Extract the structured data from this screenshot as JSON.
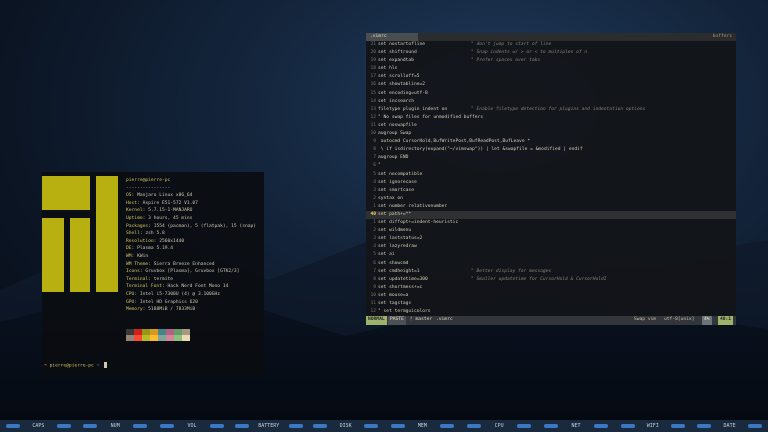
{
  "colors": {
    "accent_green": "#9fb26c",
    "manjaro_logo": "#b8b010",
    "term_key": "#d6c35e"
  },
  "terminal": {
    "user_host": "pierre@pierre-pc",
    "separator": "----------------",
    "info": [
      {
        "key": "OS",
        "value": "Manjaro Linux x86_64"
      },
      {
        "key": "Host",
        "value": "Aspire E51-572 V1.07"
      },
      {
        "key": "Kernel",
        "value": "5.7.15-1-MANJARO"
      },
      {
        "key": "Uptime",
        "value": "3 hours, 45 mins"
      },
      {
        "key": "Packages",
        "value": "1554 (pacman), 5 (flatpak), 15 (snap)"
      },
      {
        "key": "Shell",
        "value": "zsh 5.8"
      },
      {
        "key": "Resolution",
        "value": "2560x1440"
      },
      {
        "key": "DE",
        "value": "Plasma 5.19.4"
      },
      {
        "key": "WM",
        "value": "KWin"
      },
      {
        "key": "WM Theme",
        "value": "Sierra Breeze Enhanced"
      },
      {
        "key": "Icons",
        "value": "Gruvbox [Plasma], Gruvbox [GTK2/3]"
      },
      {
        "key": "Terminal",
        "value": "termite"
      },
      {
        "key": "Terminal Font",
        "value": "Hack Nerd Font Mono 14"
      },
      {
        "key": "CPU",
        "value": "Intel i5-7300U (4) @ 3.100GHz"
      },
      {
        "key": "GPU",
        "value": "Intel HD Graphics 620"
      },
      {
        "key": "Memory",
        "value": "5188MiB / 7833MiB"
      }
    ],
    "palette_row1": [
      "#3c3836",
      "#cc241d",
      "#98971a",
      "#d79921",
      "#458588",
      "#b16286",
      "#689d6a",
      "#a89984"
    ],
    "palette_row2": [
      "#928374",
      "#fb4934",
      "#b8bb26",
      "#fabd2f",
      "#83a598",
      "#d3869b",
      "#8ec07c",
      "#ebdbb2"
    ],
    "prompt": {
      "arrow": "➜",
      "host": "pierre@pierre-pc",
      "path": "~"
    }
  },
  "vim": {
    "tab_name": ".vimrc",
    "tab_right": "buffers",
    "lines": [
      {
        "num": "21",
        "code": "set nostartofline",
        "comment": "\" don't jump to start of line"
      },
      {
        "num": "20",
        "code": "set shiftround",
        "comment": "\" Snap indents w/ > or < to multiples of n"
      },
      {
        "num": "19",
        "code": "set expandtab",
        "comment": "\" Prefer spaces over tabs"
      },
      {
        "num": "18",
        "code": "set hls",
        "comment": ""
      },
      {
        "num": "17",
        "code": "set scrolloff=5",
        "comment": ""
      },
      {
        "num": "16",
        "code": "set showtabline=2",
        "comment": ""
      },
      {
        "num": "15",
        "code": "set encoding=utf-8",
        "comment": ""
      },
      {
        "num": "14",
        "code": "set incsearch",
        "comment": ""
      },
      {
        "num": "13",
        "code": "filetype plugin indent on",
        "comment": "\" Enable filetype detection for plugins and indentation options"
      },
      {
        "num": "12",
        "code": "\" No swap files for unmodified buffers",
        "comment": ""
      },
      {
        "num": "11",
        "code": "set noswapfile",
        "comment": ""
      },
      {
        "num": "10",
        "code": "augroup Swap",
        "comment": ""
      },
      {
        "num": "9",
        "code": "  autocmd CursorHold,BufWritePost,BufReadPost,BufLeave *",
        "comment": ""
      },
      {
        "num": "8",
        "code": "        \\ if isdirectory(expand(\"~/vimswap\")) | let &swapfile = &modified | endif",
        "comment": ""
      },
      {
        "num": "7",
        "code": "augroup END",
        "comment": ""
      },
      {
        "num": "6",
        "code": "\"",
        "comment": ""
      },
      {
        "num": "5",
        "code": "set nocompatible",
        "comment": ""
      },
      {
        "num": "4",
        "code": "set ignorecase",
        "comment": ""
      },
      {
        "num": "3",
        "code": "set smartcase",
        "comment": ""
      },
      {
        "num": "2",
        "code": "syntax on",
        "comment": ""
      },
      {
        "num": "1",
        "code": "set number relativenumber",
        "comment": ""
      },
      {
        "num": "40",
        "code": "set path+=**",
        "comment": ""
      },
      {
        "num": "1",
        "code": "set diffopt+=indent-heuristic",
        "comment": ""
      },
      {
        "num": "2",
        "code": "set wildmenu",
        "comment": ""
      },
      {
        "num": "3",
        "code": "set laststatus=2",
        "comment": ""
      },
      {
        "num": "4",
        "code": "set lazyredraw",
        "comment": ""
      },
      {
        "num": "5",
        "code": "set ai",
        "comment": ""
      },
      {
        "num": "6",
        "code": "set showcmd",
        "comment": ""
      },
      {
        "num": "7",
        "code": "set cmdheight=1",
        "comment": "\" Better display for messages"
      },
      {
        "num": "8",
        "code": "set updatetime=300",
        "comment": "\" Smaller updatetime for CursorHold & CursorHoldI"
      },
      {
        "num": "9",
        "code": "set shortmess+=c",
        "comment": ""
      },
      {
        "num": "10",
        "code": "set mouse=a",
        "comment": ""
      },
      {
        "num": "11",
        "code": "set tagstags",
        "comment": ""
      },
      {
        "num": "12",
        "code": "\" set termguicolors",
        "comment": ""
      }
    ],
    "status": {
      "mode": "NORMAL",
      "paste": "PASTE",
      "branch": "master",
      "filename": ".vimrc",
      "filetype": "Swap  vim",
      "encoding": "utf-8[unix]",
      "percent": "4%",
      "position": "40:1"
    }
  },
  "statusbar": {
    "segments": [
      "CAPS",
      "NUM",
      "VOL",
      "BATTERY",
      "DISK",
      "MEM",
      "CPU",
      "NET",
      "WIFI",
      "DATE"
    ]
  }
}
